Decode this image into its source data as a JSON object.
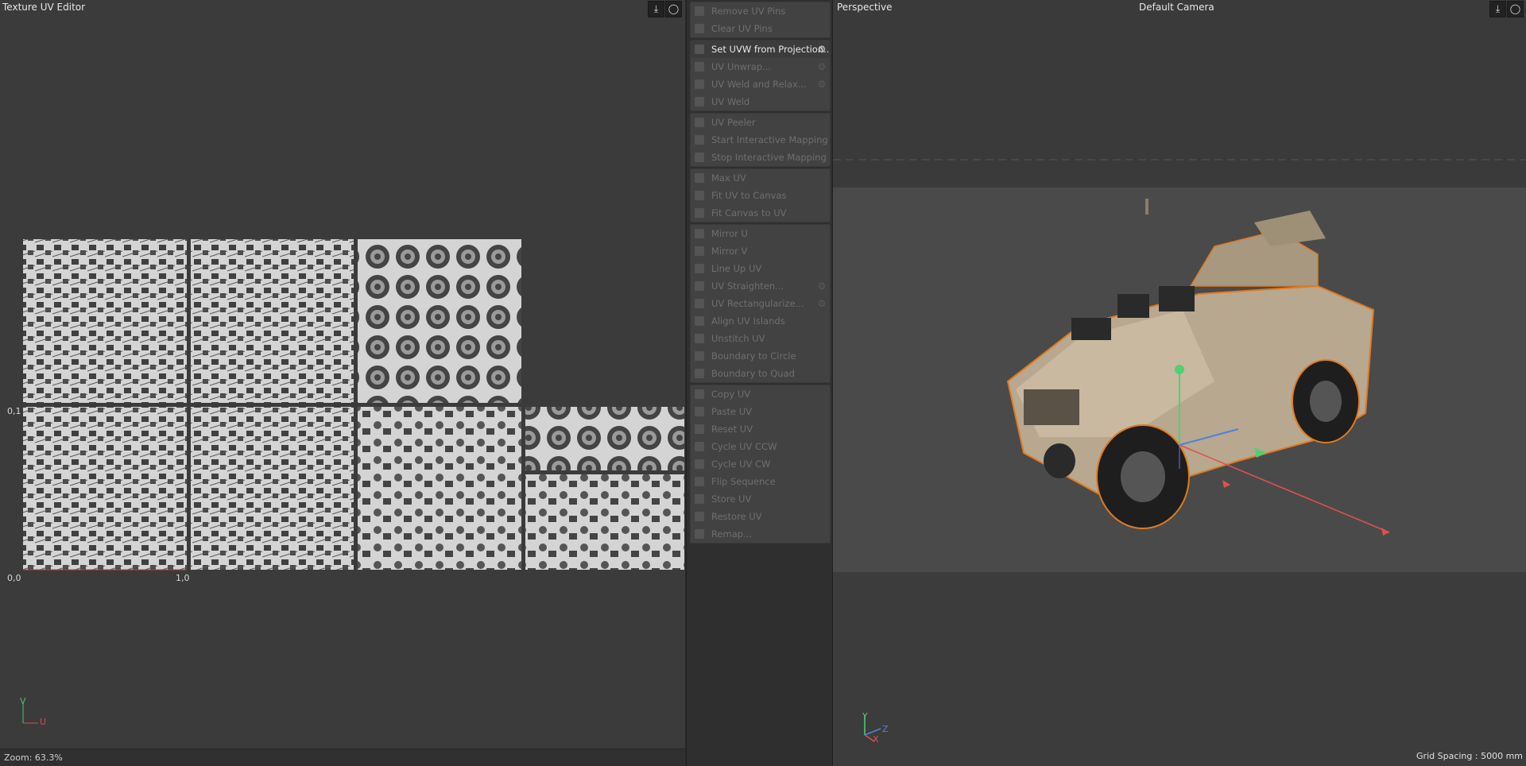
{
  "uv_editor": {
    "title": "Texture UV Editor",
    "zoom": "Zoom: 63.3%",
    "axis": {
      "origin": "0,0",
      "u1": "1,0",
      "v1": "0,1",
      "v_letter": "V",
      "u_letter": "U"
    }
  },
  "commands": {
    "groups": [
      [
        {
          "label": "Remove UV Pins",
          "enabled": false
        },
        {
          "label": "Clear UV Pins",
          "enabled": false
        }
      ],
      [
        {
          "label": "Set UVW from Projection...",
          "enabled": true,
          "gear": true
        },
        {
          "label": "UV Unwrap...",
          "enabled": false,
          "gear": true
        },
        {
          "label": "UV Weld and Relax...",
          "enabled": false,
          "gear": true
        },
        {
          "label": "UV Weld",
          "enabled": false
        }
      ],
      [
        {
          "label": "UV Peeler",
          "enabled": false
        },
        {
          "label": "Start Interactive Mapping",
          "enabled": false
        },
        {
          "label": "Stop Interactive Mapping",
          "enabled": false
        }
      ],
      [
        {
          "label": "Max UV",
          "enabled": false
        },
        {
          "label": "Fit UV to Canvas",
          "enabled": false
        },
        {
          "label": "Fit Canvas to UV",
          "enabled": false
        }
      ],
      [
        {
          "label": "Mirror U",
          "enabled": false
        },
        {
          "label": "Mirror V",
          "enabled": false
        },
        {
          "label": "Line Up UV",
          "enabled": false
        },
        {
          "label": "UV Straighten...",
          "enabled": false,
          "gear": true
        },
        {
          "label": "UV Rectangularize...",
          "enabled": false,
          "gear": true
        },
        {
          "label": "Align UV Islands",
          "enabled": false
        },
        {
          "label": "Unstitch UV",
          "enabled": false
        },
        {
          "label": "Boundary to Circle",
          "enabled": false
        },
        {
          "label": "Boundary to Quad",
          "enabled": false
        }
      ],
      [
        {
          "label": "Copy UV",
          "enabled": false
        },
        {
          "label": "Paste UV",
          "enabled": false
        },
        {
          "label": "Reset UV",
          "enabled": false
        },
        {
          "label": "Cycle UV CCW",
          "enabled": false
        },
        {
          "label": "Cycle UV CW",
          "enabled": false
        },
        {
          "label": "Flip Sequence",
          "enabled": false
        },
        {
          "label": "Store UV",
          "enabled": false
        },
        {
          "label": "Restore UV",
          "enabled": false
        },
        {
          "label": "Remap...",
          "enabled": false
        }
      ]
    ]
  },
  "viewport": {
    "title": "Perspective",
    "camera": "Default Camera",
    "grid_spacing": "Grid Spacing : 5000 mm",
    "axis": {
      "y": "Y",
      "z": "Z",
      "x": "X"
    }
  },
  "colors": {
    "accent_active": "#e8e8e8",
    "disabled_text": "#6f6f6f",
    "selection_outline": "#e07a1f",
    "axis_x": "#e05050",
    "axis_y": "#50d070",
    "axis_z": "#5080e0"
  }
}
